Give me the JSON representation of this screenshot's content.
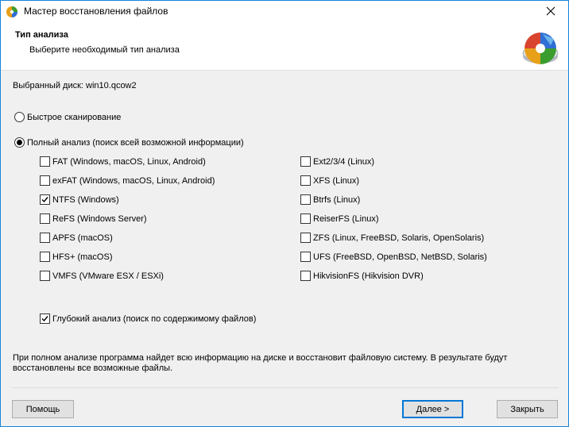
{
  "window": {
    "title": "Мастер восстановления файлов"
  },
  "header": {
    "title": "Тип анализа",
    "subtitle": "Выберите необходимый тип анализа"
  },
  "disk": {
    "label": "Выбранный диск: win10.qcow2"
  },
  "scan_options": {
    "quick": {
      "label": "Быстрое сканирование",
      "selected": false
    },
    "full": {
      "label": "Полный анализ (поиск всей возможной информации)",
      "selected": true
    }
  },
  "filesystems": {
    "left": [
      {
        "label": "FAT (Windows, macOS, Linux, Android)",
        "checked": false
      },
      {
        "label": "exFAT (Windows, macOS, Linux, Android)",
        "checked": false
      },
      {
        "label": "NTFS (Windows)",
        "checked": true
      },
      {
        "label": "ReFS (Windows Server)",
        "checked": false
      },
      {
        "label": "APFS (macOS)",
        "checked": false
      },
      {
        "label": "HFS+ (macOS)",
        "checked": false
      },
      {
        "label": "VMFS (VMware ESX / ESXi)",
        "checked": false
      }
    ],
    "right": [
      {
        "label": "Ext2/3/4 (Linux)",
        "checked": false
      },
      {
        "label": "XFS (Linux)",
        "checked": false
      },
      {
        "label": "Btrfs (Linux)",
        "checked": false
      },
      {
        "label": "ReiserFS (Linux)",
        "checked": false
      },
      {
        "label": "ZFS (Linux, FreeBSD, Solaris, OpenSolaris)",
        "checked": false
      },
      {
        "label": "UFS (FreeBSD, OpenBSD, NetBSD, Solaris)",
        "checked": false
      },
      {
        "label": "HikvisionFS (Hikvision DVR)",
        "checked": false
      }
    ]
  },
  "deep_analysis": {
    "label": "Глубокий анализ (поиск по содержимому файлов)",
    "checked": true
  },
  "info": {
    "line1": "При полном анализе программа найдет всю информацию на диске и восстановит файловую систему. В результате будут",
    "line2": "восстановлены все возможные файлы."
  },
  "buttons": {
    "help": "Помощь",
    "next": "Далее >",
    "close": "Закрыть"
  },
  "colors": {
    "accent": "#0078d7",
    "window_border": "#1883d7"
  }
}
